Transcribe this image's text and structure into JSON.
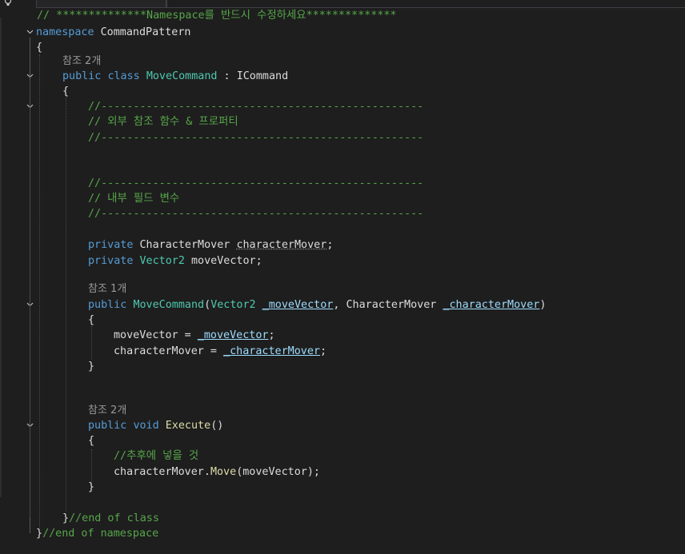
{
  "editor": {
    "lines": {
      "header_comment": "// **************Namespace를 반드시 수정하세요**************",
      "ns_kw": "namespace",
      "ns_name": "CommandPattern",
      "brace_open": "{",
      "brace_close": "}",
      "lens_class_refs": "참조 2개",
      "class_kw1": "public",
      "class_kw2": "class",
      "class_name": "MoveCommand",
      "class_sep": " : ",
      "class_iface": "ICommand",
      "sep_line": "//--------------------------------------------------",
      "comment_external": "// 외부 참조 함수 & 프로퍼티",
      "comment_internal": "// 내부 필드 변수",
      "field1_kw": "private",
      "field1_type": "CharacterMover",
      "field1_name": "characterMover",
      "field2_kw": "private",
      "field2_type": "Vector2",
      "field2_name": "moveVector",
      "semicolon": ";",
      "lens_ctor_refs": "참조 1개",
      "ctor_kw": "public",
      "ctor_name": "MoveCommand",
      "ctor_p1_type": "Vector2",
      "ctor_p1_name": "_moveVector",
      "ctor_p2_type": "CharacterMover",
      "ctor_p2_name": "_characterMover",
      "assign1_lhs": "moveVector = ",
      "assign1_rhs": "_moveVector",
      "assign2_lhs": "characterMover = ",
      "assign2_rhs": "_characterMover",
      "lens_exec_refs": "참조 2개",
      "exec_kw1": "public",
      "exec_kw2": "void",
      "exec_name": "Execute",
      "exec_parens": "()",
      "exec_comment": "//추후에 넣을 것",
      "exec_call_obj": "characterMover.",
      "exec_call_fn": "Move",
      "exec_call_args": "(moveVector);",
      "end_class_comment": "//end of class",
      "end_ns_comment": "//end of namespace"
    }
  }
}
